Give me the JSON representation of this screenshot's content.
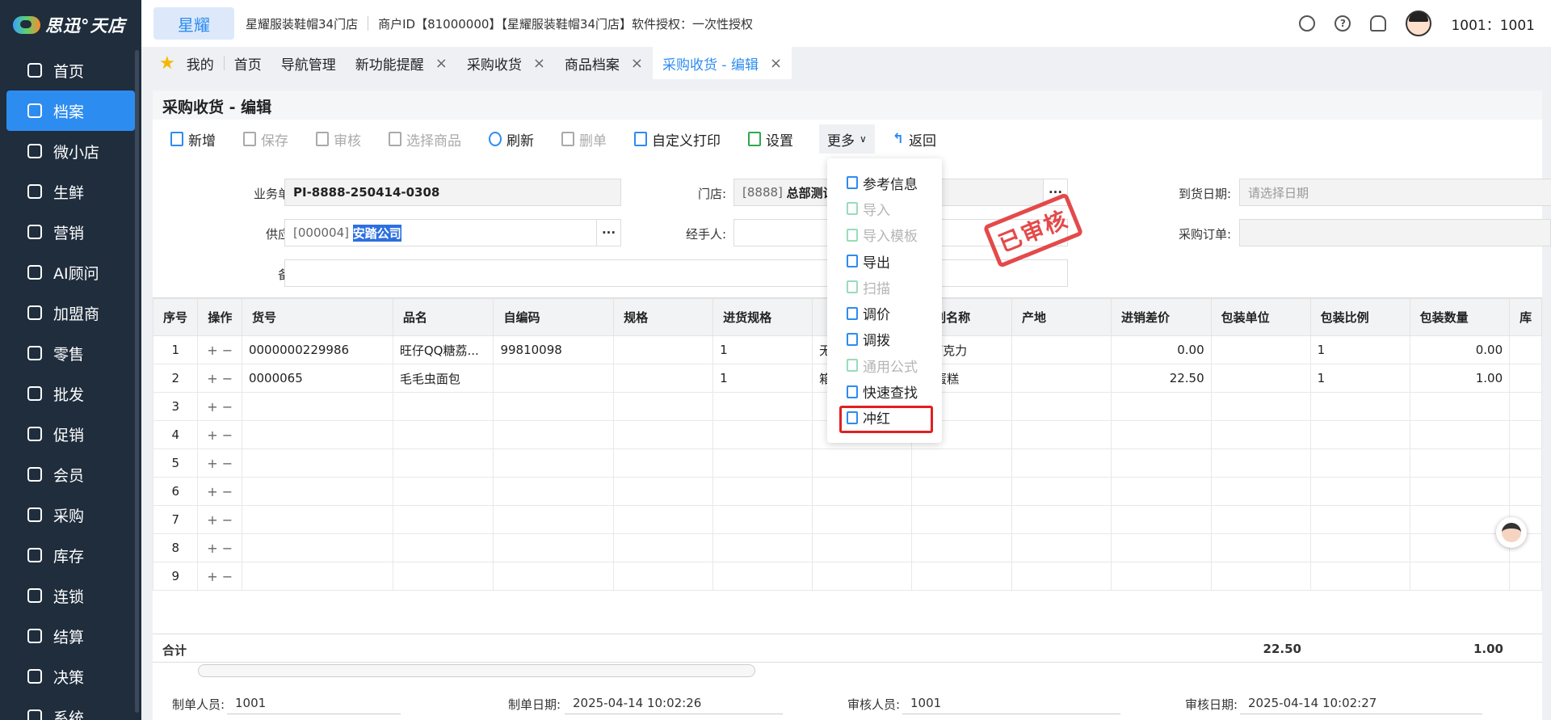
{
  "app": {
    "logo_text": "思迅°天店"
  },
  "sidebar": {
    "items": [
      {
        "label": "首页",
        "icon": "home-icon"
      },
      {
        "label": "档案",
        "icon": "folder-icon",
        "active": true
      },
      {
        "label": "微小店",
        "icon": "shop-icon"
      },
      {
        "label": "生鲜",
        "icon": "fresh-icon"
      },
      {
        "label": "营销",
        "icon": "marketing-icon"
      },
      {
        "label": "AI顾问",
        "icon": "ai-icon"
      },
      {
        "label": "加盟商",
        "icon": "franchise-icon"
      },
      {
        "label": "零售",
        "icon": "retail-icon"
      },
      {
        "label": "批发",
        "icon": "wholesale-icon"
      },
      {
        "label": "促销",
        "icon": "promotion-icon"
      },
      {
        "label": "会员",
        "icon": "member-icon"
      },
      {
        "label": "采购",
        "icon": "cart-icon"
      },
      {
        "label": "库存",
        "icon": "inventory-icon"
      },
      {
        "label": "连锁",
        "icon": "chain-icon"
      },
      {
        "label": "结算",
        "icon": "settlement-icon"
      },
      {
        "label": "决策",
        "icon": "decision-icon"
      },
      {
        "label": "系统",
        "icon": "system-icon"
      }
    ]
  },
  "header": {
    "brand": "星耀",
    "store_name": "星耀服装鞋帽34门店",
    "merchant_info": "商户ID【81000000】【星耀服装鞋帽34门店】软件授权：一次性授权",
    "user": "1001：1001"
  },
  "tabs": [
    {
      "label": "我的",
      "closable": false
    },
    {
      "label": "首页",
      "closable": false
    },
    {
      "label": "导航管理",
      "closable": false
    },
    {
      "label": "新功能提醒",
      "closable": true
    },
    {
      "label": "采购收货",
      "closable": true
    },
    {
      "label": "商品档案",
      "closable": true
    },
    {
      "label": "采购收货 - 编辑",
      "closable": true,
      "active": true
    }
  ],
  "page": {
    "title": "采购收货 - 编辑"
  },
  "toolbar": {
    "new": "新增",
    "save": "保存",
    "approve": "审核",
    "select_goods": "选择商品",
    "refresh": "刷新",
    "delete": "删单",
    "custom_print": "自定义打印",
    "settings": "设置",
    "more": "更多",
    "back": "返回"
  },
  "form": {
    "order_no_label": "业务单号:",
    "order_no": "PI-8888-250414-0308",
    "store_label": "门店:",
    "store_code": "[8888]",
    "store_name": "总部测试",
    "arrival_date_label": "到货日期:",
    "arrival_date_placeholder": "请选择日期",
    "supplier_label": "供应商:",
    "supplier_code": "[000004]",
    "supplier_name": "安踏公司",
    "handler_label": "经手人:",
    "purchase_order_label": "采购订单:",
    "remark_label": "备注:"
  },
  "stamp": "已审核",
  "grid": {
    "columns": [
      "序号",
      "操作",
      "货号",
      "品名",
      "自编码",
      "规格",
      "进货规格",
      "",
      "类别名称",
      "产地",
      "进销差价",
      "包装单位",
      "包装比例",
      "包装数量",
      "库"
    ],
    "rows": [
      {
        "seq": "1",
        "code": "0000000229986",
        "name": "旺仔QQ糖荔...",
        "self_code": "99810098",
        "spec": "",
        "purchase_spec": "1",
        "hidden": "无",
        "category": "果巧克力",
        "origin": "",
        "diff": "0.00",
        "unit": "",
        "ratio": "1",
        "qty": "0.00"
      },
      {
        "seq": "2",
        "code": "0000065",
        "name": "毛毛虫面包",
        "self_code": "",
        "spec": "",
        "purchase_spec": "1",
        "hidden": "箱",
        "category": "包/蛋糕",
        "origin": "",
        "diff": "22.50",
        "unit": "",
        "ratio": "1",
        "qty": "1.00"
      },
      {
        "seq": "3"
      },
      {
        "seq": "4"
      },
      {
        "seq": "5"
      },
      {
        "seq": "6"
      },
      {
        "seq": "7"
      },
      {
        "seq": "8"
      },
      {
        "seq": "9"
      }
    ],
    "op_symbols": "+ −",
    "total_label": "合计",
    "total_diff": "22.50",
    "total_qty": "1.00"
  },
  "footer": {
    "creator_label": "制单人员:",
    "creator": "1001",
    "created_label": "制单日期:",
    "created": "2025-04-14 10:02:26",
    "approver_label": "审核人员:",
    "approver": "1001",
    "approved_label": "审核日期:",
    "approved": "2025-04-14 10:02:27"
  },
  "more_menu": {
    "items": [
      {
        "label": "参考信息",
        "disabled": false,
        "icon": "reference-icon"
      },
      {
        "label": "导入",
        "disabled": true,
        "icon": "import-icon"
      },
      {
        "label": "导入模板",
        "disabled": true,
        "icon": "download-template-icon"
      },
      {
        "label": "导出",
        "disabled": false,
        "icon": "export-icon"
      },
      {
        "label": "扫描",
        "disabled": true,
        "icon": "scan-icon"
      },
      {
        "label": "调价",
        "disabled": false,
        "icon": "price-adjust-icon"
      },
      {
        "label": "调拨",
        "disabled": false,
        "icon": "transfer-icon"
      },
      {
        "label": "通用公式",
        "disabled": true,
        "icon": "formula-icon"
      },
      {
        "label": "快速查找",
        "disabled": false,
        "icon": "search-icon"
      },
      {
        "label": "冲红",
        "disabled": false,
        "icon": "reverse-icon",
        "highlighted": true
      }
    ]
  },
  "colors": {
    "accent": "#2d8cf0",
    "sidebar": "#1f2d3d",
    "stamp": "#e23b3b",
    "highlight": "#e02020"
  }
}
